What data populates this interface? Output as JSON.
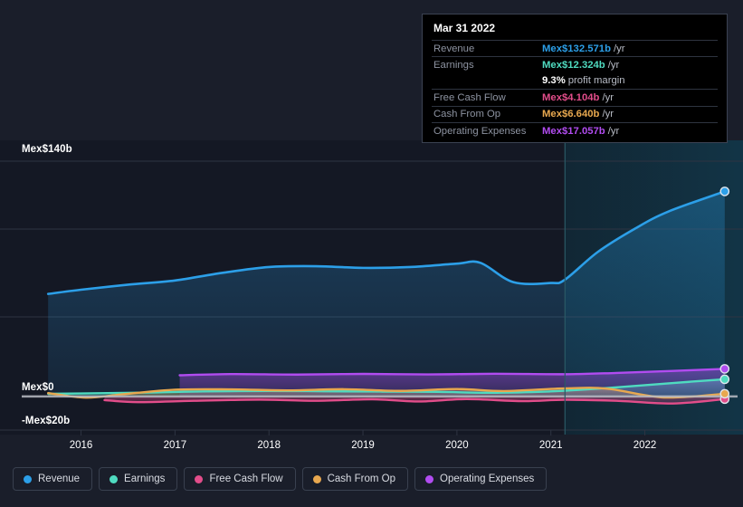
{
  "chart_data": {
    "type": "area",
    "title": "",
    "xlabel": "",
    "ylabel": "",
    "currency_prefix": "Mex$",
    "grid": true,
    "legend_position": "bottom",
    "ylim": [
      -20,
      140
    ],
    "y_ticks": [
      {
        "value": 140,
        "label": "Mex$140b"
      },
      {
        "value": 0,
        "label": "Mex$0"
      },
      {
        "value": -20,
        "label": "-Mex$20b"
      }
    ],
    "x_ticks": [
      "2016",
      "2017",
      "2018",
      "2019",
      "2020",
      "2021",
      "2022"
    ],
    "x_range": [
      "2015.6",
      "2022.9"
    ],
    "forecast_start": "2021.15",
    "series": [
      {
        "name": "Revenue",
        "color": "#2c9fe8",
        "x": [
          2015.65,
          2016.0,
          2016.5,
          2017.0,
          2017.5,
          2018.0,
          2018.5,
          2019.0,
          2019.5,
          2020.0,
          2020.25,
          2020.6,
          2021.0,
          2021.15,
          2021.5,
          2021.9,
          2022.25,
          2022.85
        ],
        "values": [
          61.0,
          63.5,
          66.5,
          69.0,
          73.5,
          77.0,
          77.5,
          76.5,
          77.0,
          79.0,
          79.5,
          68.0,
          67.5,
          69.5,
          86.0,
          100.0,
          110.0,
          122.0
        ]
      },
      {
        "name": "Earnings",
        "color": "#4fdbc0",
        "x": [
          2015.65,
          2016.2,
          2016.8,
          2017.3,
          2018.0,
          2018.6,
          2019.2,
          2019.8,
          2020.3,
          2020.8,
          2021.15,
          2021.7,
          2022.3,
          2022.85
        ],
        "values": [
          1.6,
          1.9,
          2.4,
          3.0,
          3.3,
          3.1,
          2.9,
          2.7,
          2.2,
          2.6,
          3.4,
          5.4,
          8.0,
          10.2
        ]
      },
      {
        "name": "Free Cash Flow",
        "color": "#e24d8a",
        "x": [
          2016.25,
          2016.6,
          2017.2,
          2017.9,
          2018.5,
          2019.1,
          2019.6,
          2020.1,
          2020.7,
          2021.15,
          2021.7,
          2022.3,
          2022.85
        ],
        "values": [
          -2.2,
          -3.4,
          -2.6,
          -1.9,
          -2.6,
          -1.7,
          -3.0,
          -1.6,
          -2.8,
          -2.0,
          -2.6,
          -4.2,
          -1.6
        ]
      },
      {
        "name": "Cash From Op",
        "color": "#e8a84f",
        "x": [
          2015.65,
          2016.05,
          2016.45,
          2017.0,
          2017.6,
          2018.2,
          2018.8,
          2019.4,
          2020.0,
          2020.5,
          2021.15,
          2021.6,
          2022.2,
          2022.85
        ],
        "values": [
          2.0,
          -0.7,
          1.3,
          4.0,
          4.2,
          3.6,
          4.3,
          3.3,
          4.4,
          3.2,
          4.8,
          4.6,
          -0.6,
          1.6
        ]
      },
      {
        "name": "Operating Expenses",
        "color": "#b14cf0",
        "x": [
          2017.05,
          2017.6,
          2018.3,
          2019.0,
          2019.7,
          2020.4,
          2021.15,
          2021.7,
          2022.3,
          2022.85
        ],
        "values": [
          12.6,
          13.3,
          13.0,
          13.4,
          13.1,
          13.5,
          13.2,
          14.0,
          15.2,
          16.4
        ]
      }
    ]
  },
  "tooltip": {
    "date": "Mar 31 2022",
    "rows": [
      {
        "name": "Revenue",
        "value": "Mex$132.571b",
        "unit": "/yr",
        "color": "#2c9fe8",
        "sub": false
      },
      {
        "name": "Earnings",
        "value": "Mex$12.324b",
        "unit": "/yr",
        "color": "#4fdbc0",
        "sub": false
      },
      {
        "name": "",
        "value": "9.3%",
        "unit": "profit margin",
        "color": "#ffffff",
        "sub": true
      },
      {
        "name": "Free Cash Flow",
        "value": "Mex$4.104b",
        "unit": "/yr",
        "color": "#e24d8a",
        "sub": false
      },
      {
        "name": "Cash From Op",
        "value": "Mex$6.640b",
        "unit": "/yr",
        "color": "#e8a84f",
        "sub": false
      },
      {
        "name": "Operating Expenses",
        "value": "Mex$17.057b",
        "unit": "/yr",
        "color": "#b14cf0",
        "sub": false
      }
    ]
  },
  "legend": {
    "items": [
      {
        "label": "Revenue",
        "color": "#2c9fe8"
      },
      {
        "label": "Earnings",
        "color": "#4fdbc0"
      },
      {
        "label": "Free Cash Flow",
        "color": "#e24d8a"
      },
      {
        "label": "Cash From Op",
        "color": "#e8a84f"
      },
      {
        "label": "Operating Expenses",
        "color": "#b14cf0"
      }
    ]
  },
  "colors": {
    "background": "#1a1e2a",
    "plot_background": "#141824",
    "forecast_background": "#122230",
    "gridline": "#2e3442",
    "zero_line": "#b9bcc4",
    "divider": "#2a5a66"
  }
}
